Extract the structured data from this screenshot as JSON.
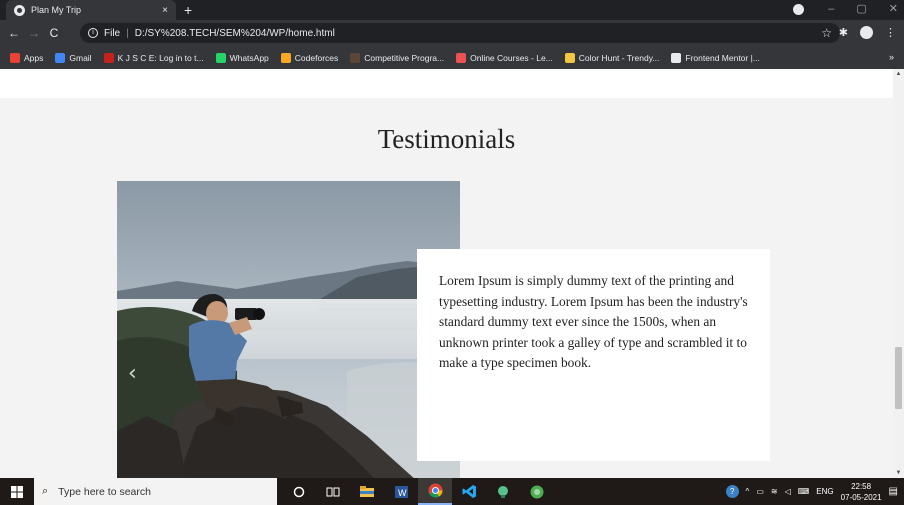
{
  "browser": {
    "tab_title": "Plan My Trip",
    "tab_close": "×",
    "new_tab": "+",
    "address_scheme_label": "File",
    "address_url": "D:/SY%208.TECH/SEM%204/WP/home.html",
    "window_controls": [
      "–",
      "▢",
      "✕"
    ]
  },
  "bookmarks": [
    {
      "label": "Apps",
      "icon": "apps-grid-icon",
      "color": "#ea4335"
    },
    {
      "label": "Gmail",
      "icon": "google-icon",
      "color": "#4285f4"
    },
    {
      "label": "K J S C E: Log in to t...",
      "icon": "kjsce-icon",
      "color": "#c5221f"
    },
    {
      "label": "WhatsApp",
      "icon": "whatsapp-icon",
      "color": "#25d366"
    },
    {
      "label": "Codeforces",
      "icon": "codeforces-icon",
      "color": "#f9a825"
    },
    {
      "label": "Competitive Progra...",
      "icon": "cc-icon",
      "color": "#5b4638"
    },
    {
      "label": "Online Courses - Le...",
      "icon": "udemy-icon",
      "color": "#ec5252"
    },
    {
      "label": "Color Hunt - Trendy...",
      "icon": "colorhunt-icon",
      "color": "#f4c542"
    },
    {
      "label": "Frontend Mentor |...",
      "icon": "frontendmentor-icon",
      "color": "#e8eaed"
    }
  ],
  "bookmarks_more": "»",
  "page": {
    "section_title": "Testimonials",
    "testimonial_text": "Lorem Ipsum is simply dummy text of the printing and typesetting industry. Lorem Ipsum has been the industry's standard dummy text ever since the 1500s, when an unknown printer took a galley of type and scrambled it to make a type specimen book.",
    "slider_prev": "‹",
    "photo_alt_icon": "photographer-photo"
  },
  "taskbar": {
    "search_placeholder": "Type here to search",
    "language": "ENG",
    "time": "22:58",
    "date": "07-05-2021",
    "pinned": [
      "cortana-icon",
      "task-view-icon",
      "file-explorer-icon",
      "word-icon",
      "chrome-icon",
      "vscode-icon",
      "app-icon",
      "app2-icon"
    ]
  }
}
